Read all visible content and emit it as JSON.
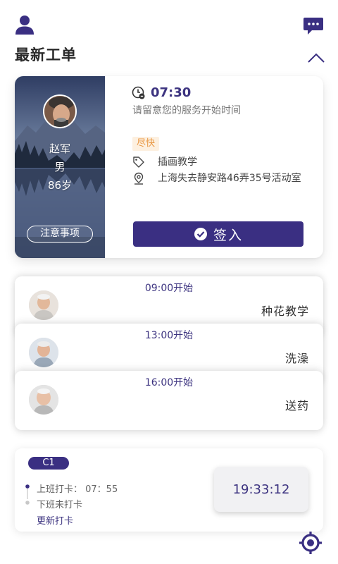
{
  "header": {
    "title": "最新工单",
    "user_icon": "user-icon",
    "chat_icon": "chat-icon",
    "collapse_icon": "chevron-up-icon"
  },
  "featured": {
    "client": {
      "name": "赵军",
      "gender": "男",
      "age": "86岁"
    },
    "notes_label": "注意事项",
    "start_time": "07:30",
    "reminder": "请留意您的服务开始时间",
    "urgency": "尽快",
    "service": "插画教学",
    "address": "上海失去静安路46弄35号活动室",
    "checkin_label": "签入"
  },
  "orders": [
    {
      "time": "09:00开始",
      "service": "种花教学"
    },
    {
      "time": "13:00开始",
      "service": "洗澡"
    },
    {
      "time": "16:00开始",
      "service": "送药"
    }
  ],
  "attendance": {
    "shift": "C1",
    "punch_in": "上班打卡： 07：55",
    "punch_out": "下班未打卡",
    "update": "更新打卡",
    "clock": "19:33:12"
  },
  "colors": {
    "primary": "#3a2f82",
    "accent": "#e99640"
  }
}
